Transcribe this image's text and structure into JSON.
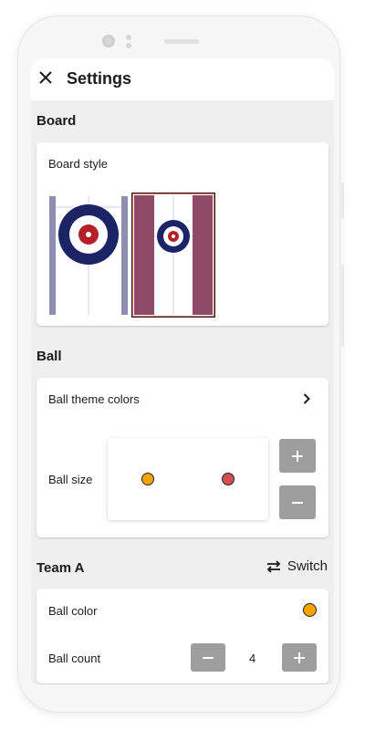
{
  "header": {
    "title": "Settings",
    "close_icon": "close-icon"
  },
  "board": {
    "section_title": "Board",
    "style_label": "Board style",
    "styles": [
      {
        "name": "classic",
        "selected": false,
        "rail_color": "#8e8eb0",
        "ring_color": "#1c2466",
        "button_color": "#b51f28"
      },
      {
        "name": "maroon",
        "selected": true,
        "rail_color": "#8e4a66",
        "ring_color": "#1c2466",
        "button_color": "#b51f28",
        "border_color": "#e8685a"
      }
    ]
  },
  "ball": {
    "section_title": "Ball",
    "theme_colors_label": "Ball theme colors",
    "size_label": "Ball size",
    "preview_colors": [
      "#f5a300",
      "#d45050"
    ],
    "increase_icon": "plus-icon",
    "decrease_icon": "minus-icon"
  },
  "team_a": {
    "section_title": "Team A",
    "switch_label": "Switch",
    "switch_icon": "swap-arrows-icon",
    "color_label": "Ball color",
    "color": "#f5a300",
    "count_label": "Ball count",
    "count_value": "4"
  },
  "colors": {
    "accent_button": "#9e9e9e",
    "background": "#efefef"
  }
}
